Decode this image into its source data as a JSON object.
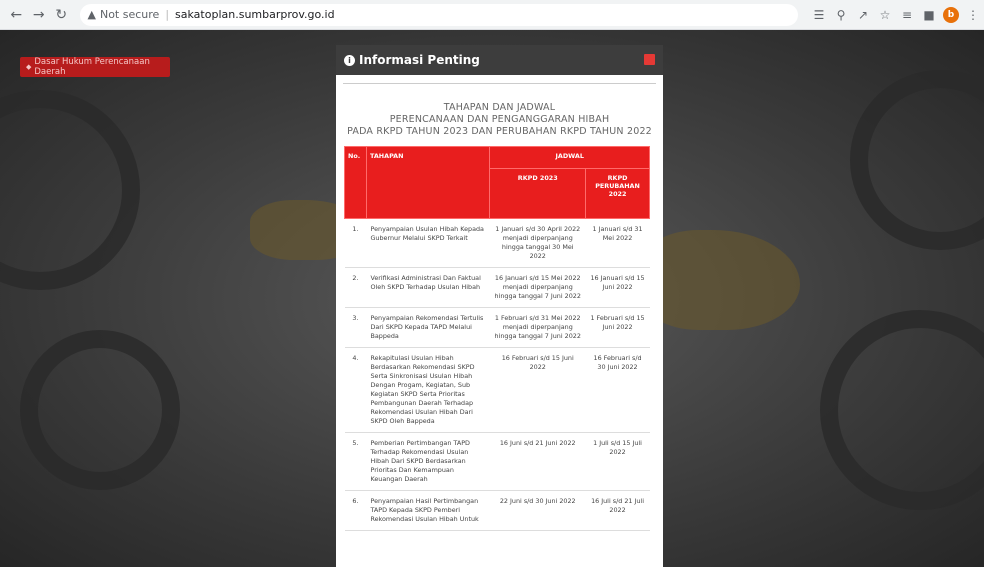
{
  "browser": {
    "security_label": "Not secure",
    "url": "sakatoplan.sumbarprov.go.id",
    "profile_initial": "b"
  },
  "page": {
    "side_button_label": "Dasar Hukum Perencanaan Daerah"
  },
  "modal": {
    "title": "Informasi Penting",
    "heading_line1": "TAHAPAN DAN JADWAL",
    "heading_line2": "PERENCANAAN DAN PENGANGGARAN HIBAH",
    "heading_line3": "PADA RKPD TAHUN 2023 DAN PERUBAHAN RKPD TAHUN 2022",
    "table": {
      "col_no": "No.",
      "col_stage": "TAHAPAN",
      "col_schedule": "JADWAL",
      "col_rkpd": "RKPD 2023",
      "col_perub": "RKPD PERUBAHAN 2022",
      "rows": [
        {
          "no": "1.",
          "stage": "Penyampaian Usulan Hibah Kepada Gubernur Melalui SKPD Terkait",
          "rkpd": "1 Januari s/d 30 April 2022 menjadi diperpanjang hingga tanggal 30 Mei 2022",
          "perub": "1 Januari s/d 31 Mei 2022"
        },
        {
          "no": "2.",
          "stage": "Verifikasi Administrasi Dan Faktual Oleh SKPD Terhadap Usulan Hibah",
          "rkpd": "16 Januari s/d 15 Mei 2022 menjadi diperpanjang hingga tanggal 7 Juni 2022",
          "perub": "16 Januari s/d 15 Juni 2022"
        },
        {
          "no": "3.",
          "stage": "Penyampaian Rekomendasi Tertulis Dari SKPD Kepada TAPD Melalui Bappeda",
          "rkpd": "1 Februari s/d 31 Mei 2022 menjadi diperpanjang hingga tanggal 7 Juni 2022",
          "perub": "1 Februari s/d 15 Juni 2022"
        },
        {
          "no": "4.",
          "stage": "Rekapitulasi Usulan Hibah Berdasarkan Rekomendasi SKPD Serta Sinkronisasi Usulan Hibah Dengan Progam, Kegiatan, Sub Kegiatan SKPD Serta Prioritas Pembangunan Daerah Terhadap Rekomendasi Usulan Hibah Dari SKPD Oleh Bappeda",
          "rkpd": "16 Februari s/d 15 Juni 2022",
          "perub": "16 Februari s/d 30 Juni 2022"
        },
        {
          "no": "5.",
          "stage": "Pemberian Pertimbangan TAPD Terhadap Rekomendasi Usulan Hibah Dari SKPD Berdasarkan Prioritas Dan Kemampuan Keuangan Daerah",
          "rkpd": "16 Juni s/d 21 Juni 2022",
          "perub": "1 Juli s/d 15 Juli 2022"
        },
        {
          "no": "6.",
          "stage": "Penyampaian Hasil Pertimbangan TAPD Kepada SKPD Pemberi Rekomendasi Usulan Hibah Untuk",
          "rkpd": "22 Juni s/d 30 Juni 2022",
          "perub": "16 Juli s/d 21 Juli 2022"
        }
      ]
    }
  }
}
